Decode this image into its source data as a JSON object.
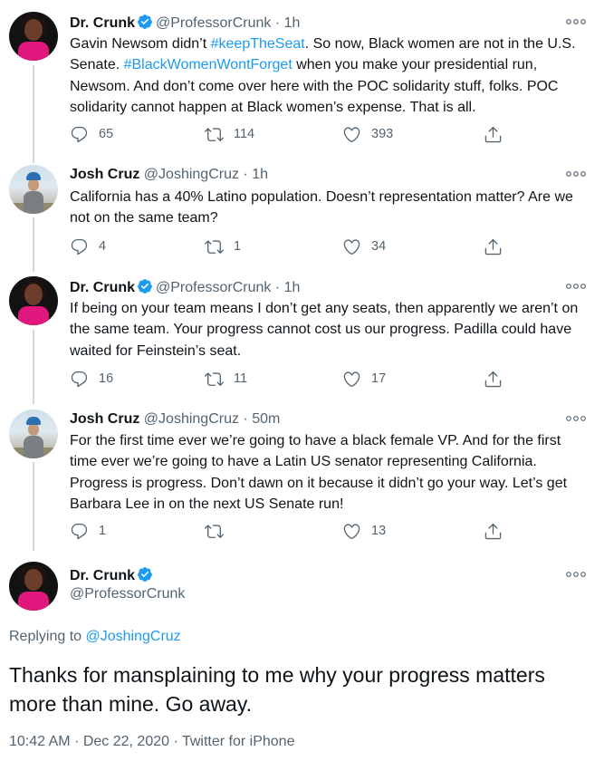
{
  "colors": {
    "link": "#1d9bf0",
    "muted": "#536471",
    "text": "#0f1419",
    "verified": "#1d9bf0"
  },
  "icons": {
    "reply": "reply-icon",
    "retweet": "retweet-icon",
    "like": "like-icon",
    "share": "share-icon",
    "more": "more-icon",
    "verified": "verified-badge-icon"
  },
  "tweets": [
    {
      "name": "Dr. Crunk",
      "verified": true,
      "handle": "@ProfessorCrunk",
      "sep": "·",
      "time": "1h",
      "text_parts": [
        "Gavin Newsom didn’t ",
        "#keepTheSeat",
        ". So now, Black women are not in the U.S. Senate. ",
        "#BlackWomenWontForget",
        " when you make your presidential run, Newsom. And don’t come over here with the POC solidarity stuff, folks. POC solidarity cannot happen at Black women’s expense. That is all."
      ],
      "replies": "65",
      "retweets": "114",
      "likes": "393"
    },
    {
      "name": "Josh Cruz",
      "verified": false,
      "handle": "@JoshingCruz",
      "sep": "·",
      "time": "1h",
      "text": "California has a 40% Latino population. Doesn’t representation matter? Are we not on the same team?",
      "replies": "4",
      "retweets": "1",
      "likes": "34"
    },
    {
      "name": "Dr. Crunk",
      "verified": true,
      "handle": "@ProfessorCrunk",
      "sep": "·",
      "time": "1h",
      "text": "If being on your team means I don’t get any seats, then apparently we aren’t on the same team. Your progress cannot cost us our progress. Padilla could have waited for Feinstein’s seat.",
      "replies": "16",
      "retweets": "11",
      "likes": "17"
    },
    {
      "name": "Josh Cruz",
      "verified": false,
      "handle": "@JoshingCruz",
      "sep": "·",
      "time": "50m",
      "text": "For the first time ever we’re going to have a black female VP. And for the first time ever we’re going to have a Latin US senator representing California. Progress is progress. Don’t dawn on it because it didn’t go your way. Let’s get Barbara Lee in on the next US Senate run!",
      "replies": "1",
      "retweets": "",
      "likes": "13"
    }
  ],
  "main": {
    "name": "Dr. Crunk",
    "verified": true,
    "handle": "@ProfessorCrunk",
    "replying_label": "Replying to",
    "replying_handle": "@JoshingCruz",
    "text": "Thanks for mansplaining to me why your progress matters more than mine. Go away.",
    "time": "10:42 AM",
    "sep1": "·",
    "date": "Dec 22, 2020",
    "sep2": "·",
    "source": "Twitter for iPhone"
  }
}
